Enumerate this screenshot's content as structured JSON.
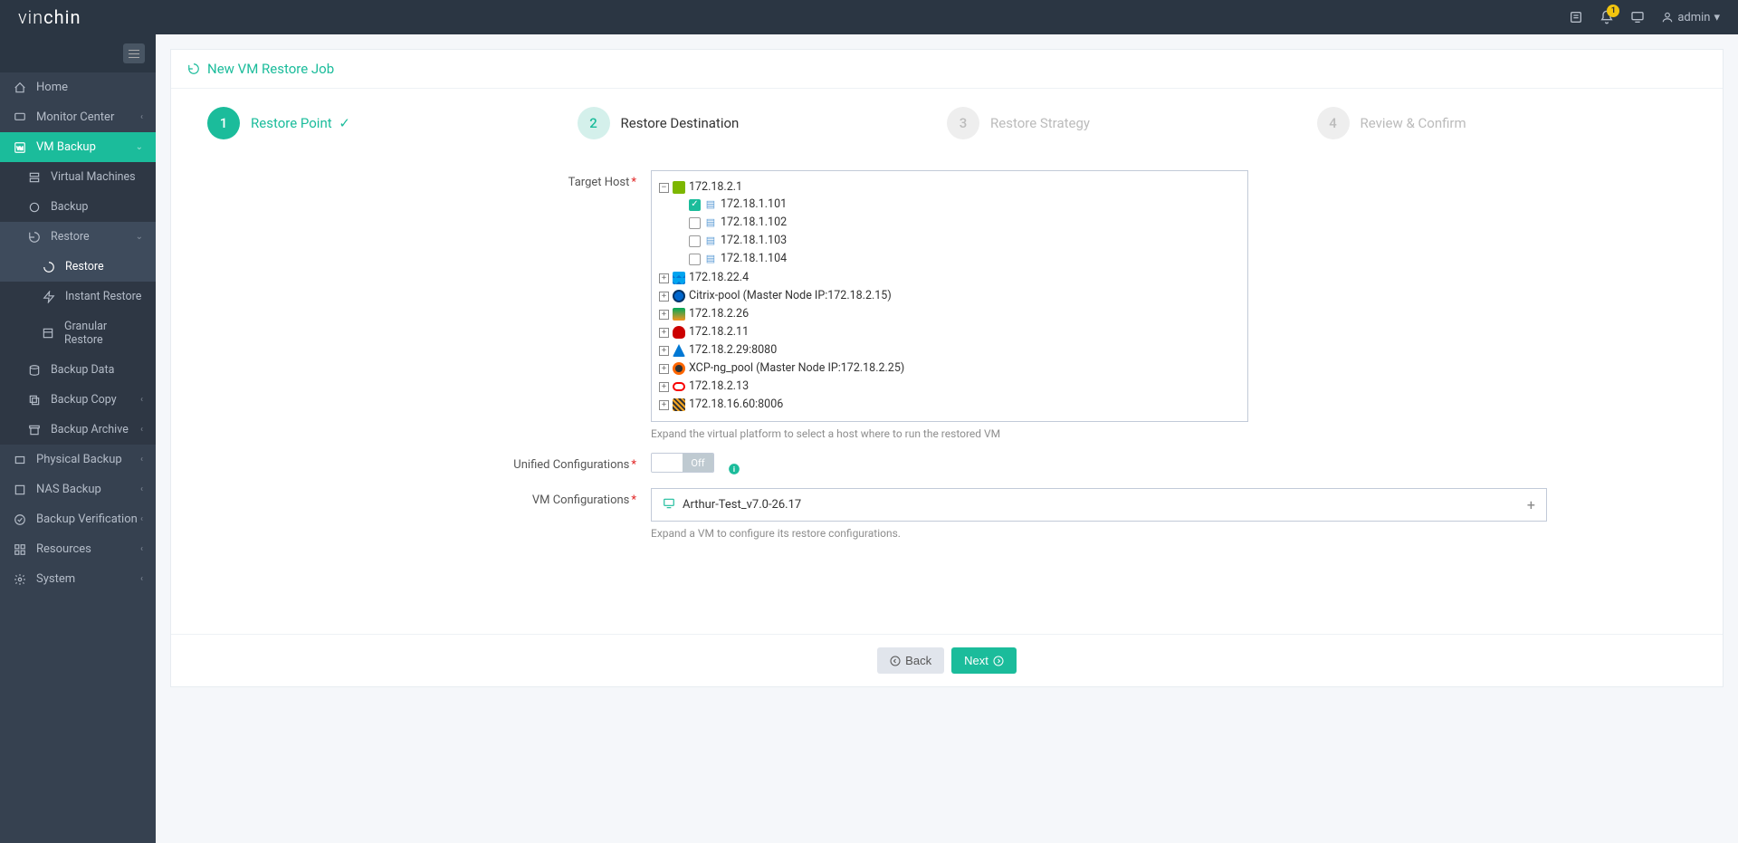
{
  "header": {
    "logo_part1": "vin",
    "logo_part2": "chin",
    "notification_count": "1",
    "user_name": "admin"
  },
  "sidebar": {
    "items": {
      "home": "Home",
      "monitor": "Monitor Center",
      "vm_backup": "VM Backup",
      "virtual_machines": "Virtual Machines",
      "backup": "Backup",
      "restore": "Restore",
      "restore_sub": "Restore",
      "instant_restore": "Instant Restore",
      "granular_restore": "Granular Restore",
      "backup_data": "Backup Data",
      "backup_copy": "Backup Copy",
      "backup_archive": "Backup Archive",
      "physical_backup": "Physical Backup",
      "nas_backup": "NAS Backup",
      "backup_verification": "Backup Verification",
      "resources": "Resources",
      "system": "System"
    }
  },
  "page": {
    "title": "New VM Restore Job",
    "steps": {
      "s1_num": "1",
      "s1_label": "Restore Point",
      "s2_num": "2",
      "s2_label": "Restore Destination",
      "s3_num": "3",
      "s3_label": "Restore Strategy",
      "s4_num": "4",
      "s4_label": "Review & Confirm"
    },
    "labels": {
      "target_host": "Target Host",
      "unified_config": "Unified Configurations",
      "vm_config": "VM Configurations"
    },
    "toggle_off": "Off",
    "target_host_help": "Expand the virtual platform to select a host where to run the restored VM",
    "vm_config_help": "Expand a VM to configure its restore configurations.",
    "vm_config_item": "Arthur-Test_v7.0-26.17",
    "tree": {
      "root": "172.18.2.1",
      "h1": "172.18.1.101",
      "h2": "172.18.1.102",
      "h3": "172.18.1.103",
      "h4": "172.18.1.104",
      "p2": "172.18.22.4",
      "p3": "Citrix-pool (Master Node IP:172.18.2.15)",
      "p4": "172.18.2.26",
      "p5": "172.18.2.11",
      "p6": "172.18.2.29:8080",
      "p7": "XCP-ng_pool (Master Node IP:172.18.2.25)",
      "p8": "172.18.2.13",
      "p9": "172.18.16.60:8006"
    },
    "buttons": {
      "back": "Back",
      "next": "Next"
    }
  }
}
